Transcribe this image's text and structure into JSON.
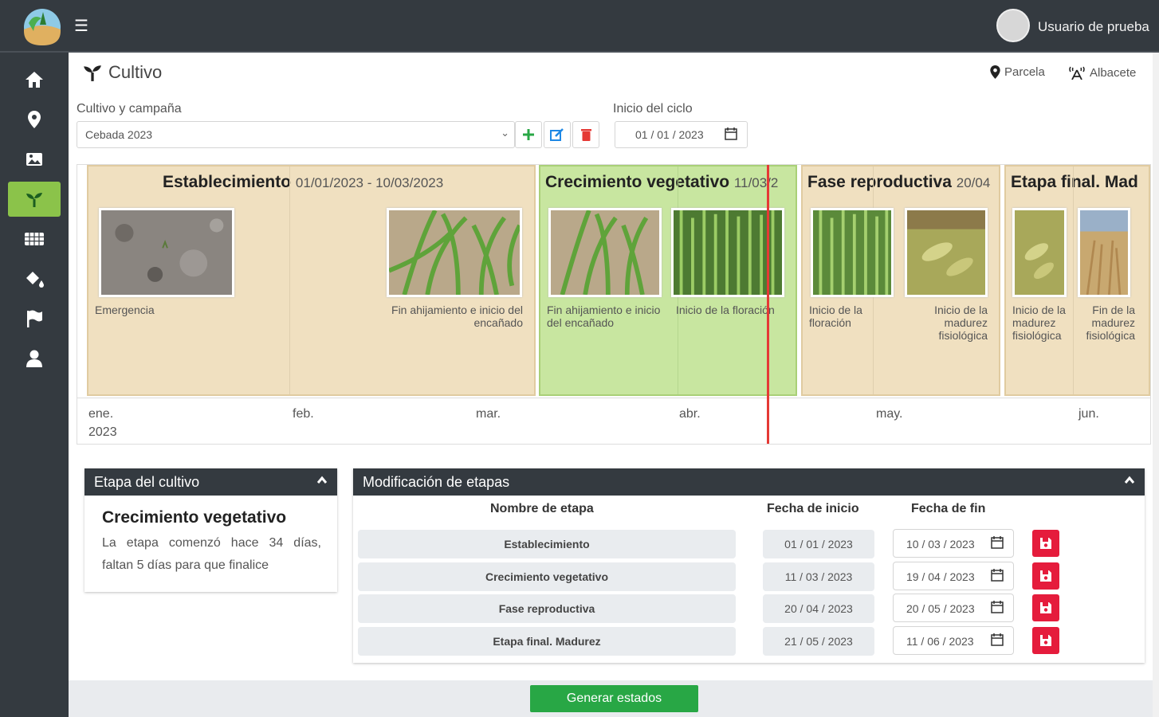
{
  "header": {
    "user_name": "Usuario de prueba"
  },
  "sidebar": {
    "items": [
      {
        "icon": "home-icon"
      },
      {
        "icon": "map-marker-icon"
      },
      {
        "icon": "image-icon"
      },
      {
        "icon": "seedling-icon",
        "active": true
      },
      {
        "icon": "grid-icon"
      },
      {
        "icon": "fill-drip-icon"
      },
      {
        "icon": "flag-icon"
      },
      {
        "icon": "user-icon"
      }
    ]
  },
  "page": {
    "title": "Cultivo",
    "parcela": "Parcela",
    "location": "Albacete"
  },
  "form": {
    "crop_label": "Cultivo y campaña",
    "crop_value": "Cebada 2023",
    "cycle_label": "Inicio del ciclo",
    "cycle_value": "01 / 01 / 2023"
  },
  "timeline": {
    "stages": [
      {
        "name": "Establecimiento",
        "dates": "01/01/2023 - 10/03/2023",
        "color": "#f0e0c0"
      },
      {
        "name": "Crecimiento vegetativo",
        "dates": "11/03/2",
        "color": "#c8e6a0"
      },
      {
        "name": "Fase reproductiva",
        "dates": "20/04",
        "color": "#f0e0c0"
      },
      {
        "name": "Etapa final. Mad",
        "dates": "",
        "color": "#f0e0c0"
      }
    ],
    "captions": [
      "Emergencia",
      "Fin ahijamiento e inicio del encañado",
      "Fin ahijamiento e inicio del encañado",
      "Inicio de la floración",
      "Inicio de la floración",
      "Inicio de la madurez fisiológica",
      "Inicio de la madurez fisiológica",
      "Fin de la madurez fisiológica"
    ],
    "axis": {
      "months": [
        "ene.",
        "feb.",
        "mar.",
        "abr.",
        "may.",
        "jun."
      ],
      "year": "2023"
    }
  },
  "etapa_card": {
    "header": "Etapa del cultivo",
    "stage": "Crecimiento vegetativo",
    "description": "La etapa comenzó hace 34 días, faltan 5 días para que finalice"
  },
  "mod_card": {
    "header": "Modificación de etapas",
    "col_name": "Nombre de etapa",
    "col_start": "Fecha de inicio",
    "col_end": "Fecha de fin",
    "rows": [
      {
        "name": "Establecimiento",
        "start": "01 / 01 / 2023",
        "end": "10 / 03 / 2023"
      },
      {
        "name": "Crecimiento vegetativo",
        "start": "11 / 03 / 2023",
        "end": "19 / 04 / 2023"
      },
      {
        "name": "Fase reproductiva",
        "start": "20 / 04 / 2023",
        "end": "20 / 05 / 2023"
      },
      {
        "name": "Etapa final. Madurez",
        "start": "21 / 05 / 2023",
        "end": "11 / 06 / 2023"
      }
    ]
  },
  "actions": {
    "generate": "Generar estados"
  }
}
